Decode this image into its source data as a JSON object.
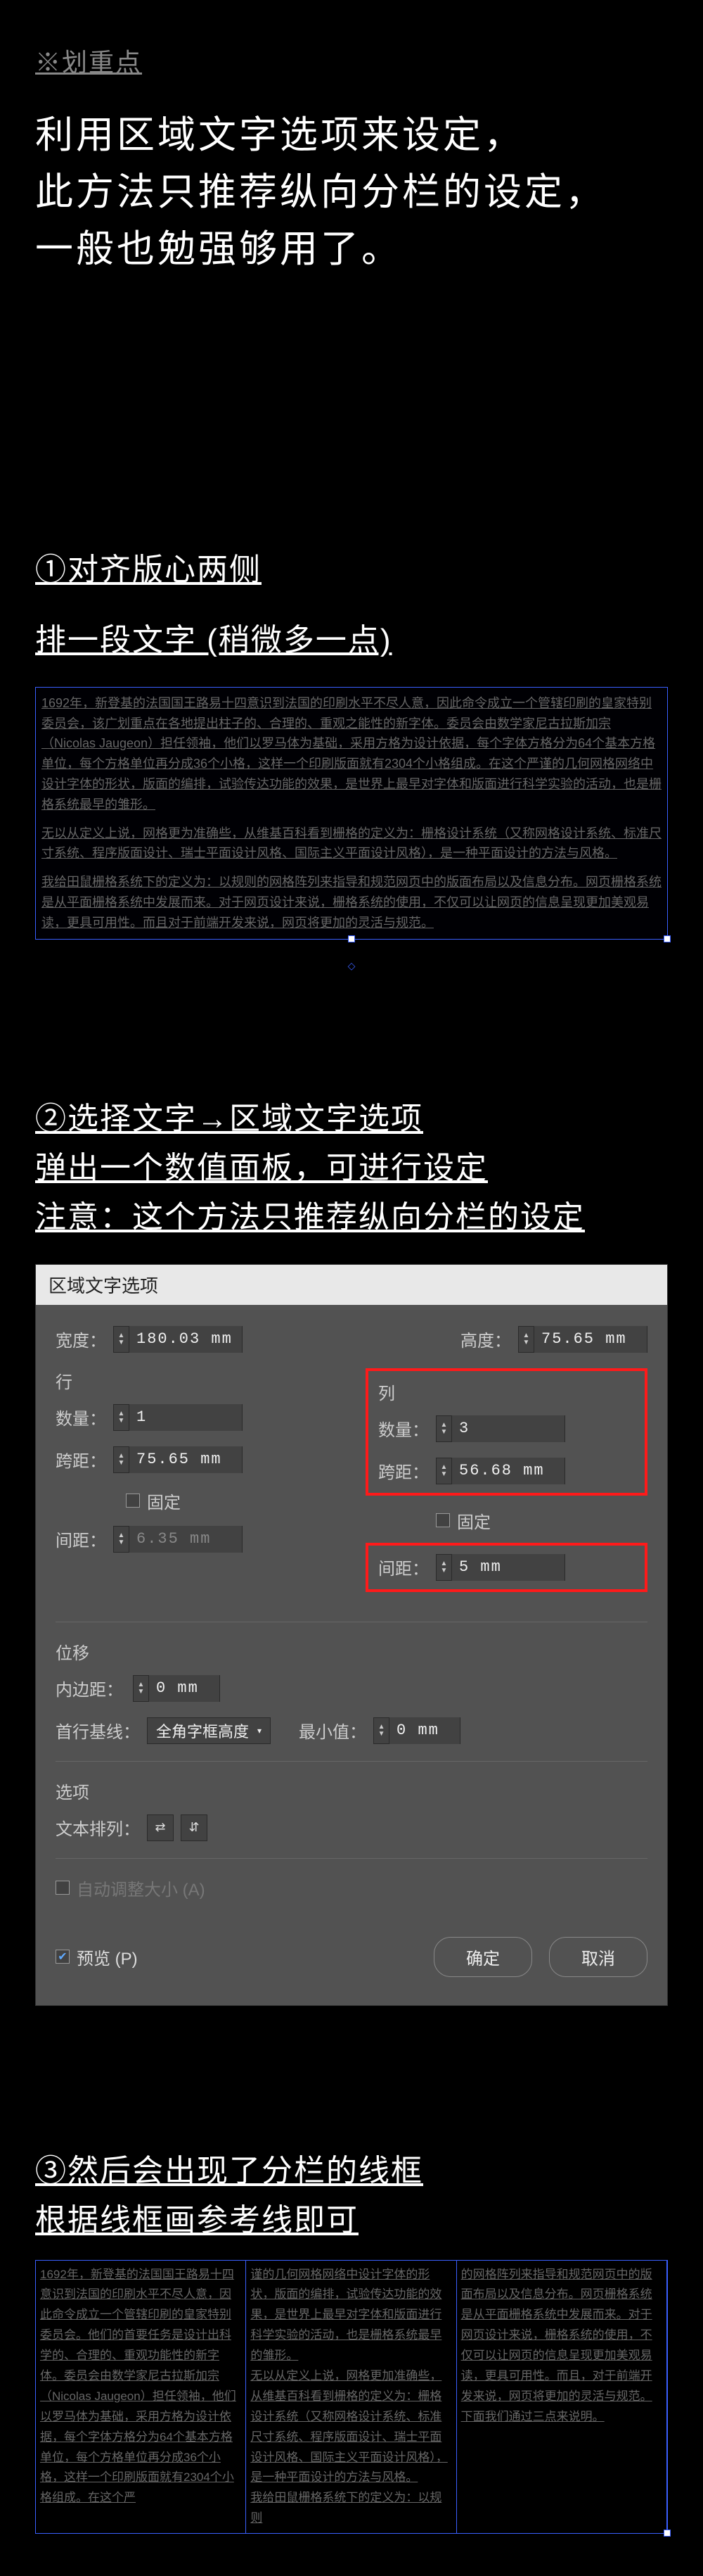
{
  "header": {
    "keypoint_label": "※划重点",
    "intro": "利用区域文字选项来设定，\n此方法只推荐纵向分栏的设定，\n一般也勉强够用了。"
  },
  "step1": {
    "heading1": "①对齐版心两侧",
    "heading2": "排一段文字 (稍微多一点)",
    "body": "1692年，新登基的法国国王路易十四意识到法国的印刷水平不尽人意，因此命令成立一个管辖印刷的皇家特别委员会，该广划重点在各地提出柱子的、合理的、重观之能性的新字体。委员会由数学家尼古拉斯加宗（Nicolas Jaugeon）担任领袖，他们以罗马体为基础，采用方格为设计依据，每个字体方格分为64个基本方格单位，每个方格单位再分成36个小格，这样一个印刷版面就有2304个小格组成。在这个严谨的几何网格网络中设计字体的形状，版面的编排，试验传达功能的效果，是世界上最早对字体和版面进行科学实验的活动，也是栅格系统最早的雏形。",
    "body2": "无以从定义上说，网格更为准确些，从维基百科看到栅格的定义为：栅格设计系统（又称网格设计系统、标准尺寸系统、程序版面设计、瑞士平面设计风格、国际主义平面设计风格），是一种平面设计的方法与风格。",
    "body3": "我给田鼠栅格系统下的定义为：以规则的网格阵列来指导和规范网页中的版面布局以及信息分布。网页栅格系统是从平面栅格系统中发展而来。对于网页设计来说，栅格系统的使用，不仅可以让网页的信息呈现更加美观易读，更具可用性。而且对于前端开发来说，网页将更加的灵活与规范。"
  },
  "step2": {
    "heading1": "②选择文字→区域文字选项",
    "heading2": "弹出一个数值面板，可进行设定",
    "heading3": "注意：这个方法只推荐纵向分栏的设定"
  },
  "dialog": {
    "title": "区域文字选项",
    "width_label": "宽度：",
    "width_value": "180.03 mm",
    "height_label": "高度：",
    "height_value": "75.65 mm",
    "rows_label": "行",
    "cols_label": "列",
    "count_label": "数量：",
    "rows_count": "1",
    "cols_count": "3",
    "span_label": "跨距：",
    "rows_span": "75.65 mm",
    "cols_span": "56.68 mm",
    "fixed_label": "固定",
    "gutter_label": "间距：",
    "rows_gutter": "6.35 mm",
    "cols_gutter": "5 mm",
    "offset_label": "位移",
    "inset_label": "内边距：",
    "inset_value": "0 mm",
    "baseline_label": "首行基线：",
    "baseline_value": "全角字框高度",
    "min_label": "最小值：",
    "min_value": "0 mm",
    "options_label": "选项",
    "textflow_label": "文本排列：",
    "autoresize_label": "自动调整大小 (A)",
    "preview_label": "预览 (P)",
    "ok": "确定",
    "cancel": "取消"
  },
  "step3": {
    "heading1": "③然后会出现了分栏的线框",
    "heading2": "根据线框画参考线即可",
    "col1": "1692年，新登基的法国国王路易十四意识到法国的印刷水平不尽人意，因此命令成立一个管辖印刷的皇家特别委员会。他们的首要任务是设计出科学的、合理的、重观功能性的新字体。委员会由数学家尼古拉斯加宗（Nicolas Jaugeon）担任领袖，他们以罗马体为基础，采用方格为设计依据，每个字体方格分为64个基本方格单位，每个方格单位再分成36个小格，这样一个印刷版面就有2304个小格组成。在这个严",
    "col2": "谨的几何网格网络中设计字体的形状，版面的编排，试验传达功能的效果，是世界上最早对字体和版面进行科学实验的活动，也是栅格系统最早的雏形。\n无以从定义上说，网格更加准确些，从维基百科看到栅格的定义为：栅格设计系统（又称网格设计系统、标准尺寸系统、程序版面设计、瑞士平面设计风格、国际主义平面设计风格），是一种平面设计的方法与风格。\n我给田鼠栅格系统下的定义为：以规则",
    "col3": "的网格阵列来指导和规范网页中的版面布局以及信息分布。网页栅格系统是从平面栅格系统中发展而来。对于网页设计来说，栅格系统的使用，不仅可以让网页的信息呈现更加美观易读，更具可用性。而且，对于前端开发来说，网页将更加的灵活与规范。\n下面我们通过三点来说明。"
  }
}
